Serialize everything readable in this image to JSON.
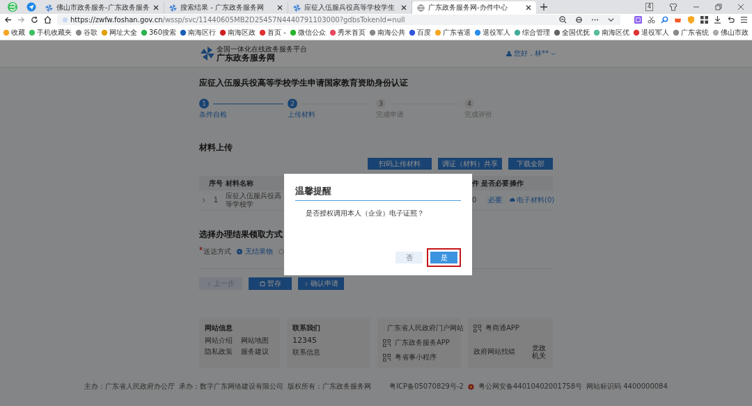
{
  "browser": {
    "tabs": [
      {
        "title": "佛山市政务服务-广东政务服务",
        "selected": false
      },
      {
        "title": "搜索结果 - 广东政务服务网",
        "selected": false
      },
      {
        "title": "应征入伍服兵役高等学校学生",
        "selected": false
      },
      {
        "title": "广东政务服务网-办件中心",
        "selected": true
      }
    ],
    "tab_count": "4",
    "url_host": "https://zwfw.foshan.gov.cn",
    "url_path": "/wssp/svc/11440605MB2D25457N4440791103000?gdbsTokenId=null",
    "bookmarks": [
      "收藏",
      "手机收藏夹",
      "谷歌",
      "网址大全",
      "360搜索",
      "南海区行",
      "南海区政",
      "首页 -",
      "微信公众",
      "秀米首页",
      "南海公共",
      "百度",
      "广东省退",
      "退役军人",
      "综合管理",
      "全国优抚",
      "南海区优",
      "退役军人",
      "广东省统",
      "佛山市政"
    ]
  },
  "site": {
    "tagline": "全国一体化在线政务服务平台",
    "name": "广东政务服务网",
    "user": "您好，林**"
  },
  "page_title": "应征入伍服兵役高等学校学生申请国家教育资助身份认证",
  "steps": [
    {
      "number": "1",
      "label": "条件自检",
      "active": true
    },
    {
      "number": "2",
      "label": "上传材料",
      "active": true
    },
    {
      "number": "3",
      "label": "完成申请",
      "active": false
    },
    {
      "number": "4",
      "label": "完成评价",
      "active": false
    }
  ],
  "materials": {
    "title": "材料上传",
    "actions": [
      "扫码上传材料",
      "调证（材料）共享",
      "下载全部"
    ],
    "columns_left": [
      "序号",
      "材料名称"
    ],
    "columns_right": [
      "件",
      "是否必要",
      "操作"
    ],
    "rows": [
      {
        "number": "1",
        "name": "应征入伍服兵役高等学校学",
        "count": "0",
        "required": "必要",
        "action": "电子材料(0)"
      }
    ]
  },
  "receipt": {
    "title": "选择办理结果领取方式",
    "field_label": "送达方式",
    "required": true,
    "options": [
      {
        "label": "无结果物",
        "selected": true
      },
      {
        "selected": false
      }
    ]
  },
  "nav_buttons": [
    {
      "label": "上一步",
      "kind": "prev",
      "disabled": true
    },
    {
      "label": "暂存",
      "kind": "save",
      "disabled": false
    },
    {
      "label": "确认申请",
      "kind": "submit",
      "disabled": false
    }
  ],
  "footer": {
    "site_info": {
      "title": "网站信息",
      "links": [
        "网站介绍",
        "网站地图",
        "隐私政策",
        "服务建议"
      ]
    },
    "contact": {
      "title": "联系我们",
      "phone": "12345",
      "link": "联系信息"
    },
    "apps": [
      "广东省人民政府门户网站",
      "广东政务服务APP",
      "粤省事小程序"
    ],
    "app_right": "粤商通APP",
    "error_link": "政府网站找错",
    "party_badge": "党政机关",
    "bottom": [
      "主办：广东省人民政府办公厅",
      "承办：数字广东网络建设有限公司",
      "版权所有：广东政务服务网",
      "粤ICP备05070829号-2",
      "粤公网安备44010402001758号",
      "网站标识码 4400000084"
    ]
  },
  "dialog": {
    "title": "温馨提醒",
    "message": "是否授权调用本人（企业）电子证照？",
    "buttons": [
      {
        "label": "否",
        "kind": "secondary",
        "highlighted": false
      },
      {
        "label": "是",
        "kind": "primary",
        "highlighted": true
      }
    ]
  }
}
